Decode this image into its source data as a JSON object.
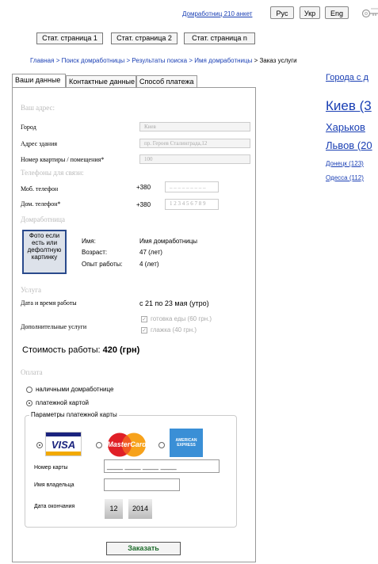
{
  "header": {
    "housekeepers_link": "Домработниц 210 анкет",
    "languages": [
      "Рус",
      "Укр",
      "Eng"
    ],
    "key_icon": "key-icon"
  },
  "nav": [
    "Стат. страница 1",
    "Стат. страница 2",
    "Стат. страница n"
  ],
  "breadcrumb": {
    "items": [
      "Главная",
      "Поиск домработницы",
      "Результаты поиска",
      "Имя домработницы"
    ],
    "separator": ">",
    "current": "Заказ услуги"
  },
  "tabs": [
    "Ваши данные",
    "Контактные данные",
    "Способ платежа"
  ],
  "address": {
    "section": "Ваш адрес:",
    "city_label": "Город",
    "city_value": "Киев",
    "building_label": "Адрес здания",
    "building_value": "пр. Героев Сталинграда,12",
    "apartment_label": "Номер квартиры / помещения*",
    "apartment_value": "100"
  },
  "phones": {
    "section": "Телефоны для связи:",
    "mobile_label": "Моб. телефон",
    "mobile_prefix": "+380",
    "mobile_value": "_ _ _ _ _ _ _ _ _",
    "home_label": "Дом. телефон*",
    "home_prefix": "+380",
    "home_value": "1 2 3 4 5 6 7 8 9"
  },
  "housekeeper": {
    "section": "Домработница",
    "photo_text": "Фото если есть или дефолтную картинку",
    "name_label": "Имя:",
    "name_value": "Имя домработницы",
    "age_label": "Возраст:",
    "age_value": "47 (лет)",
    "experience_label": "Опыт работы:",
    "experience_value": "4 (лет)"
  },
  "service": {
    "section": "Услуга",
    "datetime_label": "Дата и время работы",
    "datetime_value": "с 21 по 23 мая (утро)",
    "extras_label": "Дополнительные услуги",
    "extras": [
      "готовка еды (60 грн.)",
      "глажка (40 грн.)"
    ]
  },
  "cost": {
    "label": "Стоимость работы:",
    "value": "420 (грн)"
  },
  "payment": {
    "section": "Оплата",
    "options": [
      "наличными домработнице",
      "платежной картой"
    ],
    "selected": 1,
    "card_params_title": "Параметры платежной карты",
    "cards": [
      "VISA",
      "MasterCard",
      "AMERICAN EXPRESS"
    ],
    "selected_card": 0,
    "card_number_label": "Номер карты",
    "card_number_value": "____ ____ ____ ____",
    "owner_label": "Имя владельца",
    "owner_value": "",
    "expiry_label": "Дата окончания",
    "expiry_month": "12",
    "expiry_year": "2014"
  },
  "submit_label": "Заказать",
  "cities": {
    "title": "Города с д",
    "items": [
      "Киев (3",
      "Харьков",
      "Львов (20",
      "Донецк (123)",
      "Одесса (112)"
    ]
  }
}
